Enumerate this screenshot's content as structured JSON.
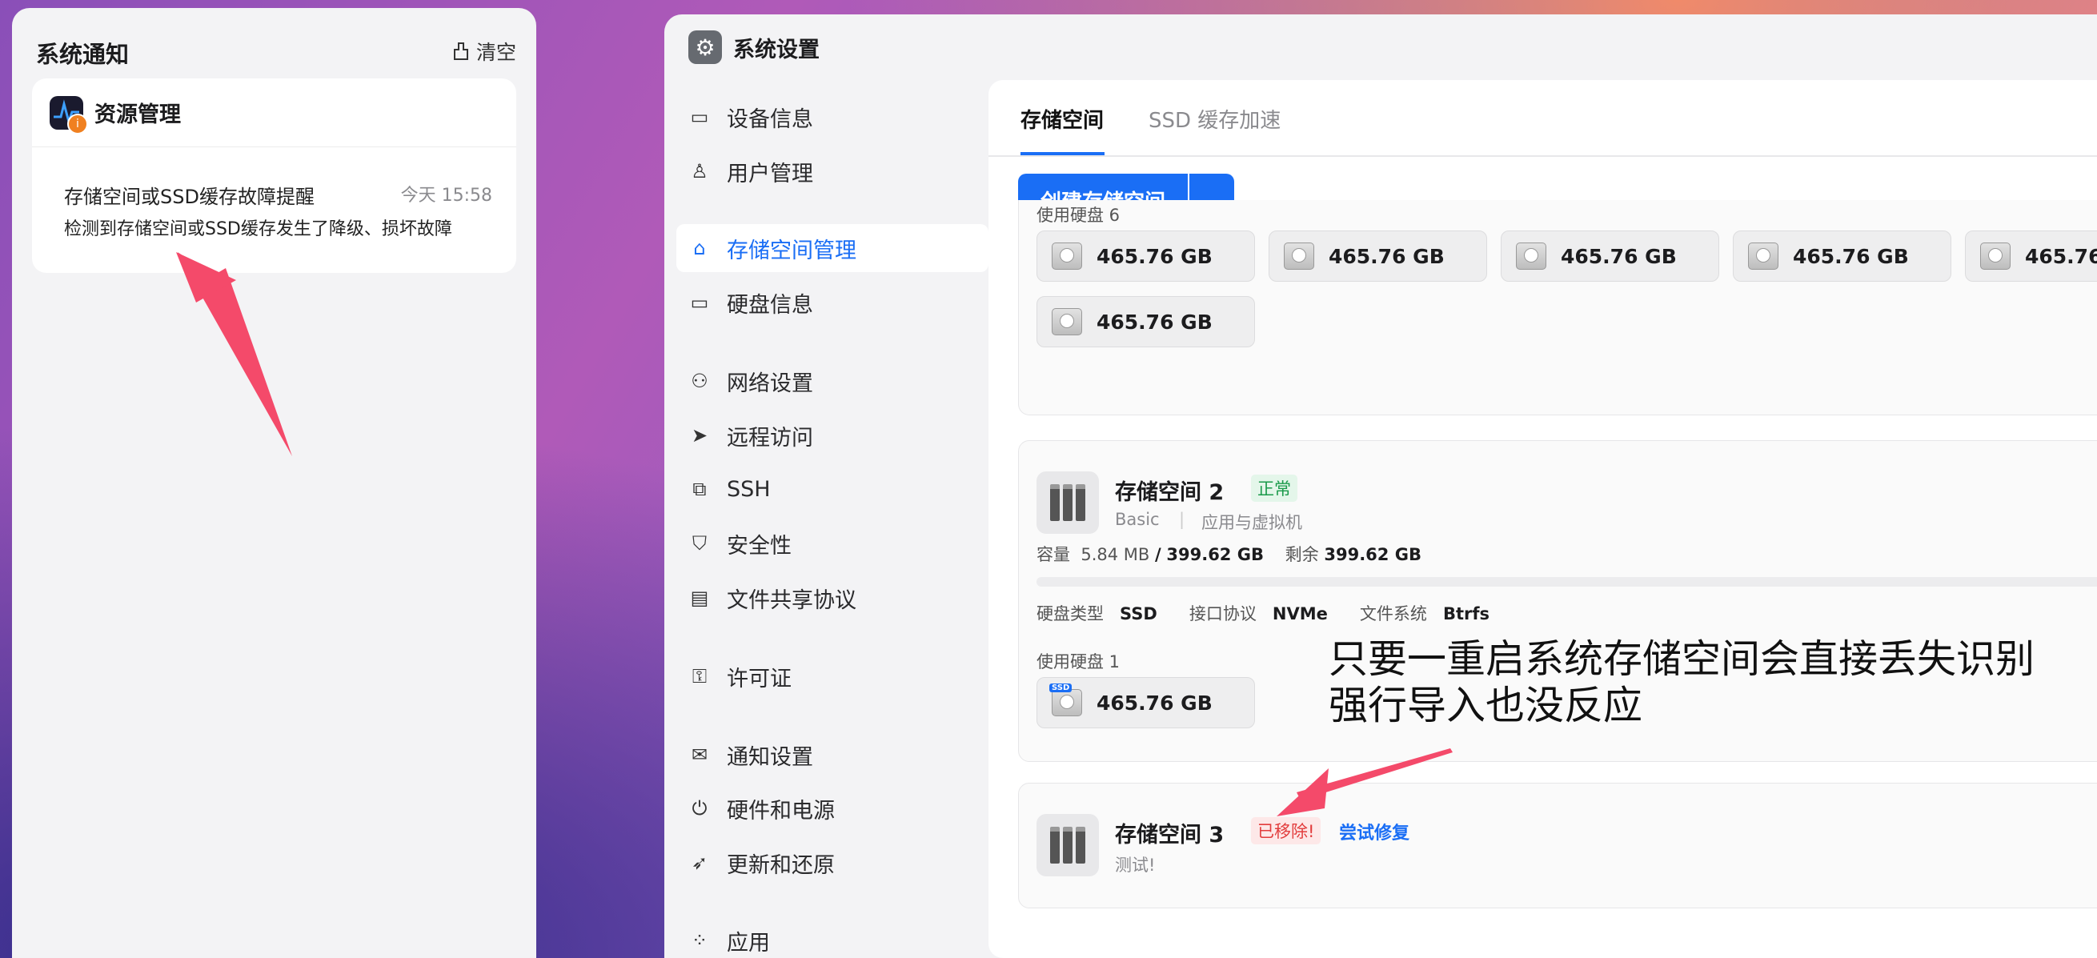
{
  "notifications": {
    "title": "系统通知",
    "clear_label": "清空",
    "card": {
      "app_name": "资源管理",
      "message_title": "存储空间或SSD缓存故障提醒",
      "time": "今天 15:58",
      "message_body": "检测到存储空间或SSD缓存发生了降级、损坏故障"
    }
  },
  "settings": {
    "title": "系统设置",
    "sidebar": [
      {
        "label": "设备信息",
        "icon": "drive-icon"
      },
      {
        "label": "用户管理",
        "icon": "user-icon"
      },
      {
        "label": "存储空间管理",
        "icon": "storage-icon",
        "active": true
      },
      {
        "label": "硬盘信息",
        "icon": "disk-icon"
      },
      {
        "label": "网络设置",
        "icon": "network-icon"
      },
      {
        "label": "远程访问",
        "icon": "send-icon"
      },
      {
        "label": "SSH",
        "icon": "ssh-icon"
      },
      {
        "label": "安全性",
        "icon": "shield-icon"
      },
      {
        "label": "文件共享协议",
        "icon": "document-icon"
      },
      {
        "label": "许可证",
        "icon": "key-icon"
      },
      {
        "label": "通知设置",
        "icon": "mail-icon"
      },
      {
        "label": "硬件和电源",
        "icon": "power-icon"
      },
      {
        "label": "更新和还原",
        "icon": "rocket-icon"
      },
      {
        "label": "应用",
        "icon": "apps-icon"
      }
    ],
    "tabs": [
      "存储空间",
      "SSD 缓存加速"
    ],
    "create_button": "创建存储空间",
    "pool1": {
      "disks_label": "使用硬盘 6",
      "disks": [
        "465.76 GB",
        "465.76 GB",
        "465.76 GB",
        "465.76 GB",
        "465.76",
        "465.76 GB"
      ]
    },
    "pool2": {
      "name": "存储空间 2",
      "status": "正常",
      "type": "Basic",
      "purpose": "应用与虚拟机",
      "capacity_label": "容量",
      "used": "5.84 MB",
      "sep": "/",
      "total": "399.62 GB",
      "remaining_label": "剩余",
      "remaining": "399.62 GB",
      "disk_type_label": "硬盘类型",
      "disk_type": "SSD",
      "interface_label": "接口协议",
      "interface": "NVMe",
      "fs_label": "文件系统",
      "fs": "Btrfs",
      "disks_label": "使用硬盘 1",
      "disk_ssd_tag": "SSD",
      "disk": "465.76 GB",
      "usage_fraction": 0.0
    },
    "pool3": {
      "name": "存储空间 3",
      "status": "已移除!",
      "repair": "尝试修复",
      "note": "测试!"
    }
  },
  "annotation": {
    "line1": "只要一重启系统存储空间会直接丢失识别",
    "line2": "强行导入也没反应"
  },
  "colors": {
    "accent": "#1a6ef5",
    "ok": "#1a9a4a",
    "error": "#e23c3c",
    "arrow": "#f44a6a"
  }
}
